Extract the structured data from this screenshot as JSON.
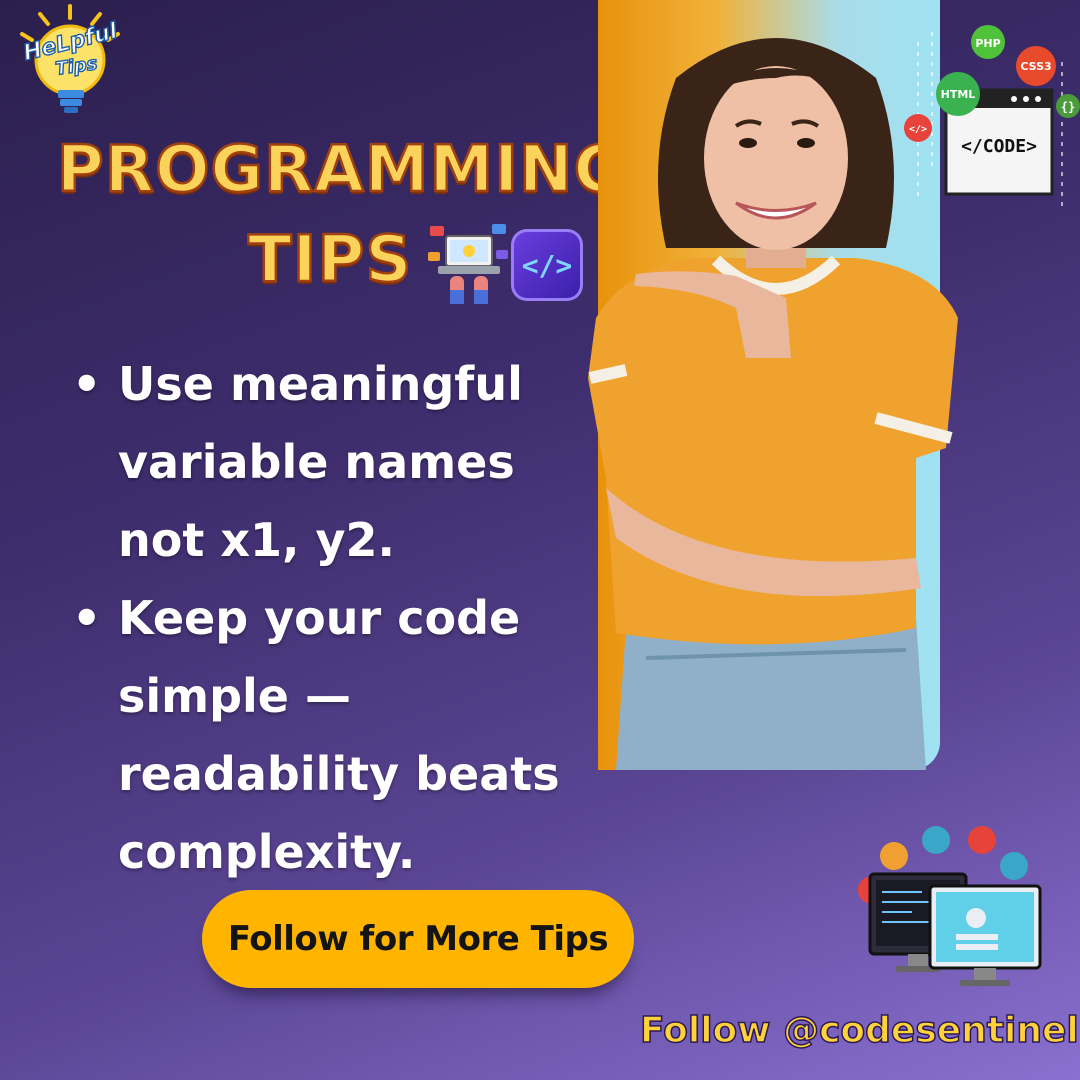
{
  "badge": {
    "line1": "HeLpful",
    "line2": "Tips"
  },
  "title": {
    "line1": "PROGRAMMING",
    "line2": "TIPS"
  },
  "code_badge": {
    "symbol": "</>"
  },
  "tips": [
    {
      "bullet": "•",
      "text": "Use meaningful variable names not x1, y2."
    },
    {
      "bullet": "•",
      "text": "Keep your code simple — readability beats complexity."
    }
  ],
  "cta": {
    "label": "Follow for More Tips"
  },
  "handle": "Follow @codesentinel",
  "code_window": {
    "php": "PHP",
    "css": "CSS3",
    "html": "HTML",
    "braces": "{}",
    "tag": "</>",
    "code": "</CODE>"
  },
  "colors": {
    "title_fill": "#fbd35a",
    "title_stroke": "#a0410f",
    "cta_bg": "#ffb400",
    "handle": "#ffd23a",
    "bg_top": "#2b1f4d",
    "bg_bottom": "#8a70d0"
  }
}
